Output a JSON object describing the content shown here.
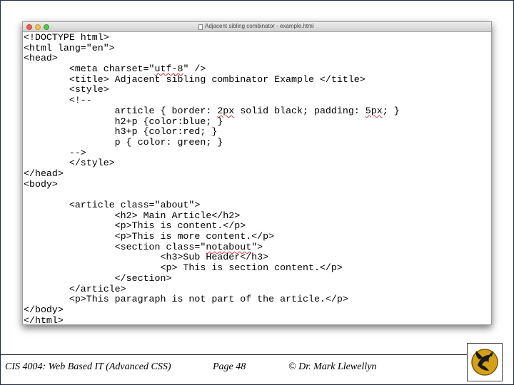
{
  "window": {
    "title": "Adjacent sibling combinator - example.html"
  },
  "code_lines": [
    "<!DOCTYPE html>",
    "<html lang=\"en\">",
    "<head>",
    "        <meta charset=\"utf-8\" />",
    "        <title> Adjacent sibling combinator Example </title>",
    "        <style>",
    "        <!--",
    "                article { border: 2px solid black; padding: 5px; }",
    "                h2+p {color:blue; }",
    "                h3+p {color:red; }",
    "                p { color: green; }",
    "        -->",
    "        </style>",
    "</head>",
    "<body>",
    "",
    "        <article class=\"about\">",
    "                <h2> Main Article</h2>",
    "                <p>This is content.</p>",
    "                <p>This is more content.</p>",
    "                <section class=\"notabout\">",
    "                        <h3>Sub Header</h3>",
    "                        <p> This is section content.</p>",
    "                </section>",
    "        </article>",
    "        <p>This paragraph is not part of the article.</p>",
    "</body>",
    "</html>"
  ],
  "footer": {
    "course": "CIS 4004: Web Based IT (Advanced CSS)",
    "page": "Page 48",
    "author": "© Dr. Mark Llewellyn"
  },
  "colors": {
    "frame": "#1a2a4a",
    "spellcheck": "#d8343f",
    "logo_gold": "#d4a017"
  },
  "icons": {
    "window_controls": [
      "close-icon",
      "minimize-icon",
      "zoom-icon"
    ],
    "document": "document-icon",
    "logo": "ucf-pegasus-logo"
  }
}
